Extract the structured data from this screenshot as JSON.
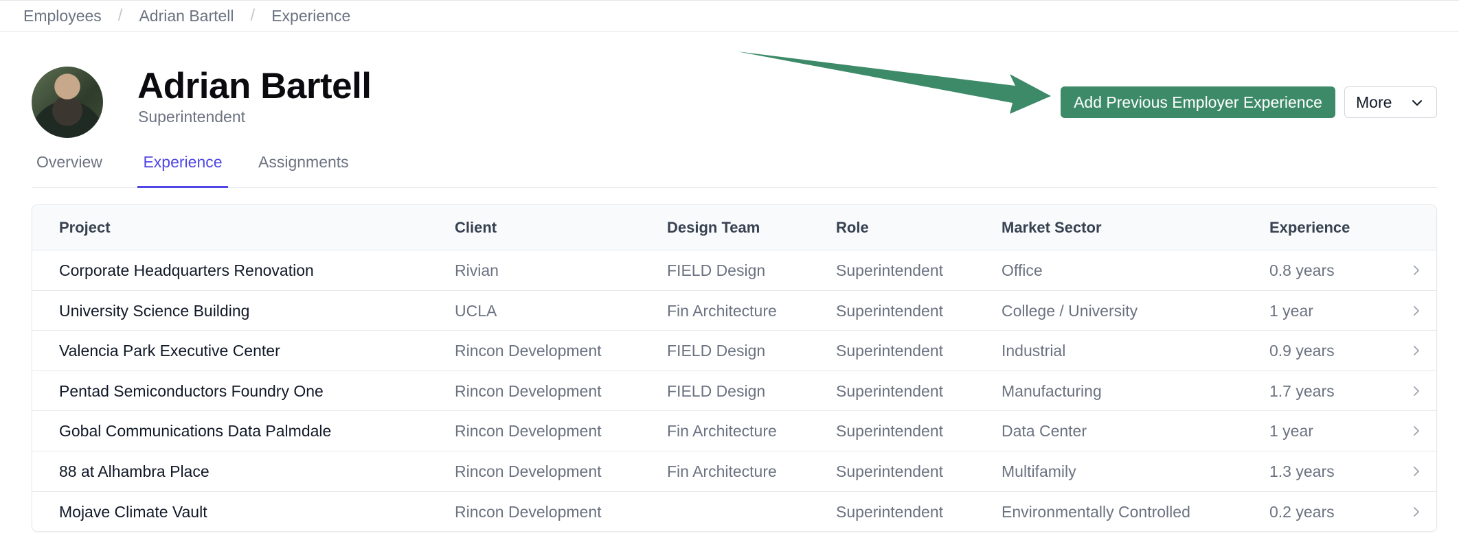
{
  "breadcrumb": [
    "Employees",
    "Adrian Bartell",
    "Experience"
  ],
  "profile": {
    "name": "Adrian Bartell",
    "title": "Superintendent"
  },
  "actions": {
    "primary_label": "Add Previous Employer Experience",
    "more_label": "More"
  },
  "tabs": [
    {
      "label": "Overview",
      "active": false
    },
    {
      "label": "Experience",
      "active": true
    },
    {
      "label": "Assignments",
      "active": false
    }
  ],
  "table": {
    "columns": [
      "Project",
      "Client",
      "Design Team",
      "Role",
      "Market Sector",
      "Experience"
    ],
    "rows": [
      [
        "Corporate Headquarters Renovation",
        "Rivian",
        "FIELD Design",
        "Superintendent",
        "Office",
        "0.8 years"
      ],
      [
        "University Science Building",
        "UCLA",
        "Fin Architecture",
        "Superintendent",
        "College / University",
        "1 year"
      ],
      [
        "Valencia Park Executive Center",
        "Rincon Development",
        "FIELD Design",
        "Superintendent",
        "Industrial",
        "0.9 years"
      ],
      [
        "Pentad Semiconductors Foundry One",
        "Rincon Development",
        "FIELD Design",
        "Superintendent",
        "Manufacturing",
        "1.7 years"
      ],
      [
        "Gobal Communications Data Palmdale",
        "Rincon Development",
        "Fin Architecture",
        "Superintendent",
        "Data Center",
        "1 year"
      ],
      [
        "88 at Alhambra Place",
        "Rincon Development",
        "Fin Architecture",
        "Superintendent",
        "Multifamily",
        "1.3 years"
      ],
      [
        "Mojave Climate Vault",
        "Rincon Development",
        "",
        "Superintendent",
        "Environmentally Controlled",
        "0.2 years"
      ]
    ]
  },
  "colors": {
    "primary": "#3d8a68",
    "accent": "#4f46e5",
    "annotation_arrow": "#3d8a68"
  }
}
